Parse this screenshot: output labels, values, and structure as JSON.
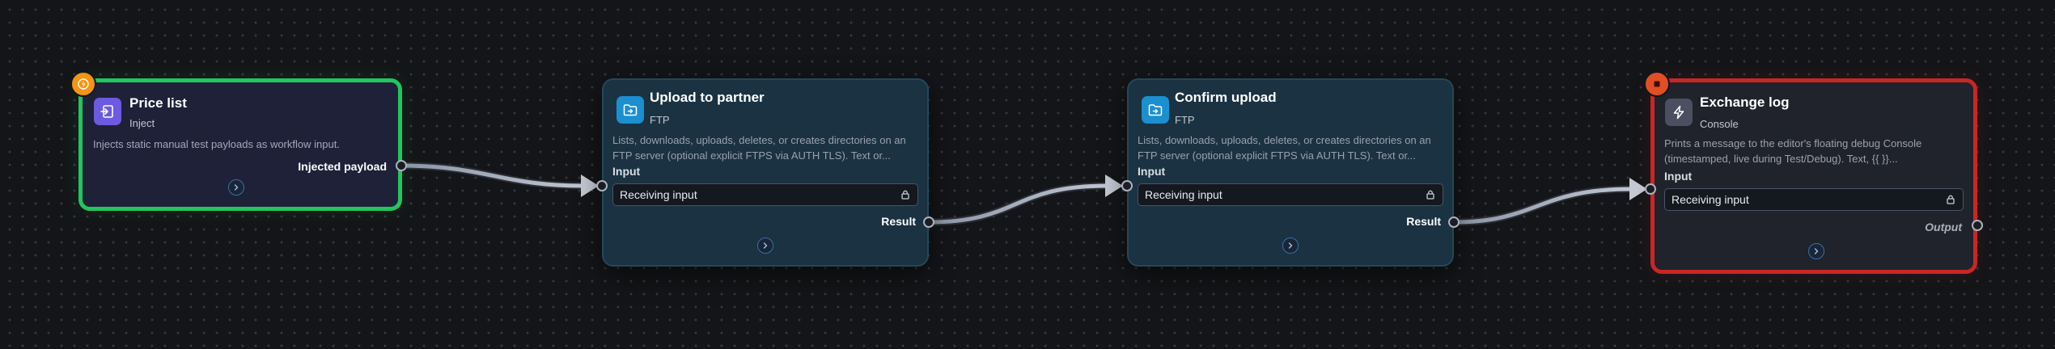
{
  "nodes": [
    {
      "id": "price-list",
      "title": "Price list",
      "type": "Inject",
      "description": "Injects static manual test payloads as workflow input.",
      "output_label": "Injected payload",
      "border_color": "#22c55e",
      "icon": "file-import-icon",
      "badge": "trigger-icon"
    },
    {
      "id": "upload-to-partner",
      "title": "Upload to partner",
      "type": "FTP",
      "description": "Lists, downloads, uploads, deletes, or creates directories on an FTP server (optional explicit FTPS via AUTH TLS). Text or...",
      "input_section_label": "Input",
      "input_value": "Receiving input",
      "output_label": "Result",
      "icon": "folder-upload-icon"
    },
    {
      "id": "confirm-upload",
      "title": "Confirm upload",
      "type": "FTP",
      "description": "Lists, downloads, uploads, deletes, or creates directories on an FTP server (optional explicit FTPS via AUTH TLS). Text or...",
      "input_section_label": "Input",
      "input_value": "Receiving input",
      "output_label": "Result",
      "icon": "folder-upload-icon"
    },
    {
      "id": "exchange-log",
      "title": "Exchange log",
      "type": "Console",
      "description": "Prints a message to the editor's floating debug Console (timestamped, live during Test/Debug). Text, {{ }}...",
      "input_section_label": "Input",
      "input_value": "Receiving input",
      "output_label": "Output",
      "border_color": "#c92626",
      "icon": "lightning-icon",
      "badge": "stop-icon"
    }
  ]
}
